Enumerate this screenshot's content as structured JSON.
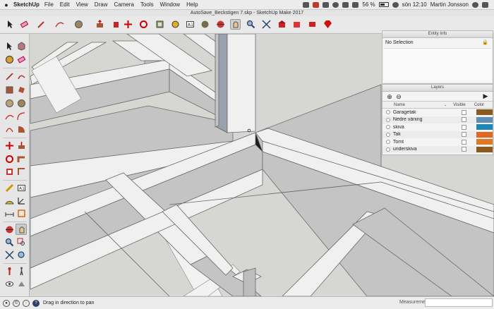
{
  "menubar": {
    "apple": "",
    "app_name": "SketchUp",
    "menus": [
      "File",
      "Edit",
      "View",
      "Draw",
      "Camera",
      "Tools",
      "Window",
      "Help"
    ],
    "battery": "56 %",
    "clock": "sön 12:10",
    "user": "Martin Jonsson"
  },
  "window": {
    "title": "AutoSave_Beckstigen 7.skp - SketchUp Make 2017"
  },
  "toolbar": {
    "icons": [
      "select-tool-icon",
      "eraser-icon",
      "pencil-icon",
      "arc-icon",
      "paint-bucket-icon",
      "push-pull-icon",
      "move-icon",
      "rotate-icon",
      "offset-icon",
      "tape-measure-icon",
      "text-icon",
      "paint-icon",
      "orbit-icon",
      "pan-icon",
      "zoom-icon",
      "zoom-extents-icon",
      "warehouse-icon",
      "extension-warehouse-icon",
      "layout-icon",
      "ruby-icon"
    ]
  },
  "entity_info": {
    "title": "Entity Info",
    "selection": "No Selection"
  },
  "layers": {
    "title": "Layers",
    "add_symbol": "⊕",
    "remove_symbol": "⊖",
    "columns": {
      "name": "Name",
      "visible": "Visible",
      "color": "Color"
    },
    "rows": [
      {
        "name": "Garagetak",
        "color": "#8a5a1e"
      },
      {
        "name": "Nedre våning",
        "color": "#5f8fb0"
      },
      {
        "name": "skiva",
        "color": "#1f86b4"
      },
      {
        "name": "Tak",
        "color": "#e06820"
      },
      {
        "name": "Tomt",
        "color": "#e07a22"
      },
      {
        "name": "underskiva",
        "color": "#8a5a1e"
      }
    ]
  },
  "statusbar": {
    "hint": "Drag in direction to pan",
    "measurements_label": "Measurements"
  },
  "colors": {
    "beam_top": "#f0f0f0",
    "beam_side": "#c4c4c4",
    "background": "#d6d6d2"
  }
}
